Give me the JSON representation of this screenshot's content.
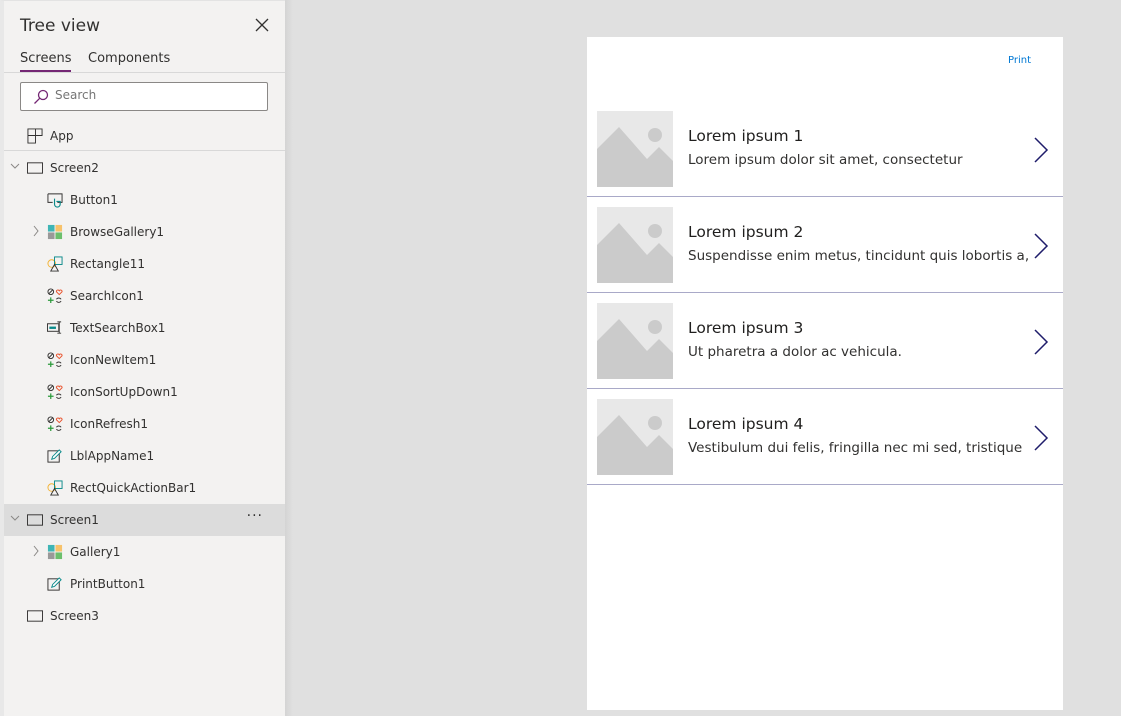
{
  "panel": {
    "title": "Tree view",
    "tabs": [
      "Screens",
      "Components"
    ],
    "search_placeholder": "Search"
  },
  "tree": [
    {
      "label": "App",
      "icon": "app-icon",
      "level": 0
    },
    {
      "label": "Screen2",
      "icon": "screen-icon",
      "level": 0,
      "expander": "expanded"
    },
    {
      "label": "Button1",
      "icon": "button-control-icon",
      "level": 1
    },
    {
      "label": "BrowseGallery1",
      "icon": "gallery-icon",
      "level": 1,
      "expander": "collapsed"
    },
    {
      "label": "Rectangle11",
      "icon": "shape-icon",
      "level": 1
    },
    {
      "label": "SearchIcon1",
      "icon": "icons-control-icon",
      "level": 1
    },
    {
      "label": "TextSearchBox1",
      "icon": "text-input-icon",
      "level": 1
    },
    {
      "label": "IconNewItem1",
      "icon": "icons-control-icon",
      "level": 1
    },
    {
      "label": "IconSortUpDown1",
      "icon": "icons-control-icon",
      "level": 1
    },
    {
      "label": "IconRefresh1",
      "icon": "icons-control-icon",
      "level": 1
    },
    {
      "label": "LblAppName1",
      "icon": "label-edit-icon",
      "level": 1
    },
    {
      "label": "RectQuickActionBar1",
      "icon": "shape-icon",
      "level": 1
    },
    {
      "label": "Screen1",
      "icon": "screen-icon",
      "level": 0,
      "expander": "expanded",
      "selected": true,
      "more": "···"
    },
    {
      "label": "Gallery1",
      "icon": "gallery-icon",
      "level": 1,
      "expander": "collapsed"
    },
    {
      "label": "PrintButton1",
      "icon": "label-edit-icon",
      "level": 1
    },
    {
      "label": "Screen3",
      "icon": "screen-icon",
      "level": 0
    }
  ],
  "canvas": {
    "print_label": "Print",
    "items": [
      {
        "title": "Lorem ipsum 1",
        "subtitle": "Lorem ipsum dolor sit amet, consectetur"
      },
      {
        "title": "Lorem ipsum 2",
        "subtitle": "Suspendisse enim metus, tincidunt quis lobortis a,"
      },
      {
        "title": "Lorem ipsum 3",
        "subtitle": "Ut pharetra a dolor ac vehicula."
      },
      {
        "title": "Lorem ipsum 4",
        "subtitle": "Vestibulum dui felis, fringilla nec mi sed, tristique"
      }
    ]
  },
  "colors": {
    "accent": "#742774",
    "link": "#0078d4",
    "chevron": "#1f1d6b",
    "divider": "#a9a9c8"
  }
}
